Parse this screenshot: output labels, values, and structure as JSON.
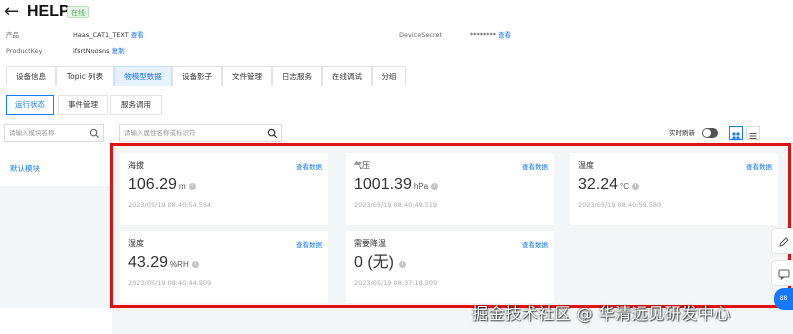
{
  "header": {
    "title": "HELP",
    "status": "在线"
  },
  "meta": {
    "product_label": "产品",
    "product_value": "Haas_CAT1_TEXT",
    "product_link": "查看",
    "productkey_label": "ProductKey",
    "productkey_value": "ifsrtNuosns",
    "productkey_link": "复制",
    "devicesecret_label": "DeviceSecret",
    "devicesecret_value": "********",
    "devicesecret_link": "查看"
  },
  "tabs": [
    {
      "label": "设备信息"
    },
    {
      "label": "Topic 列表"
    },
    {
      "label": "物模型数据",
      "active": true
    },
    {
      "label": "设备影子"
    },
    {
      "label": "文件管理"
    },
    {
      "label": "日志服务"
    },
    {
      "label": "在线调试"
    },
    {
      "label": "分组"
    }
  ],
  "subtabs": [
    {
      "label": "运行状态",
      "active": true
    },
    {
      "label": "事件管理"
    },
    {
      "label": "服务调用"
    }
  ],
  "search": {
    "module_placeholder": "请输入模块名称",
    "property_placeholder": "请输入属性名称或标识符"
  },
  "toolbar": {
    "realtime_label": "实时刷新"
  },
  "modules": [
    {
      "label": "默认模块"
    }
  ],
  "cards": [
    {
      "name": "海拔",
      "value": "106.29",
      "unit": "m",
      "time": "2023/05/19 08:40:54.554",
      "link": "查看数据"
    },
    {
      "name": "气压",
      "value": "1001.39",
      "unit": "hPa",
      "time": "2023/05/19 08:40:49.519",
      "link": "查看数据"
    },
    {
      "name": "温度",
      "value": "32.24",
      "unit": "°C",
      "time": "2023/05/19 08:40:59.580",
      "link": "查看数据"
    },
    {
      "name": "湿度",
      "value": "43.29",
      "unit": "%RH",
      "time": "2023/05/19 08:40:44.509",
      "link": "查看数据"
    },
    {
      "name": "需要降温",
      "value": "0 (无)",
      "unit": "",
      "time": "2023/05/19 08:37:18.509",
      "link": "查看数据"
    }
  ],
  "icons": {
    "back": "arrow-left-icon",
    "search": "search-icon",
    "grid_view": "grid-view-icon",
    "list_view": "list-view-icon",
    "edit": "edit-icon",
    "message": "message-icon"
  },
  "colors": {
    "accent": "#1677ff",
    "highlight": "#e0120f",
    "online": "#52a860"
  },
  "watermark": "掘金技术社区 @ 华清远见研发中心",
  "fab_label": "88"
}
